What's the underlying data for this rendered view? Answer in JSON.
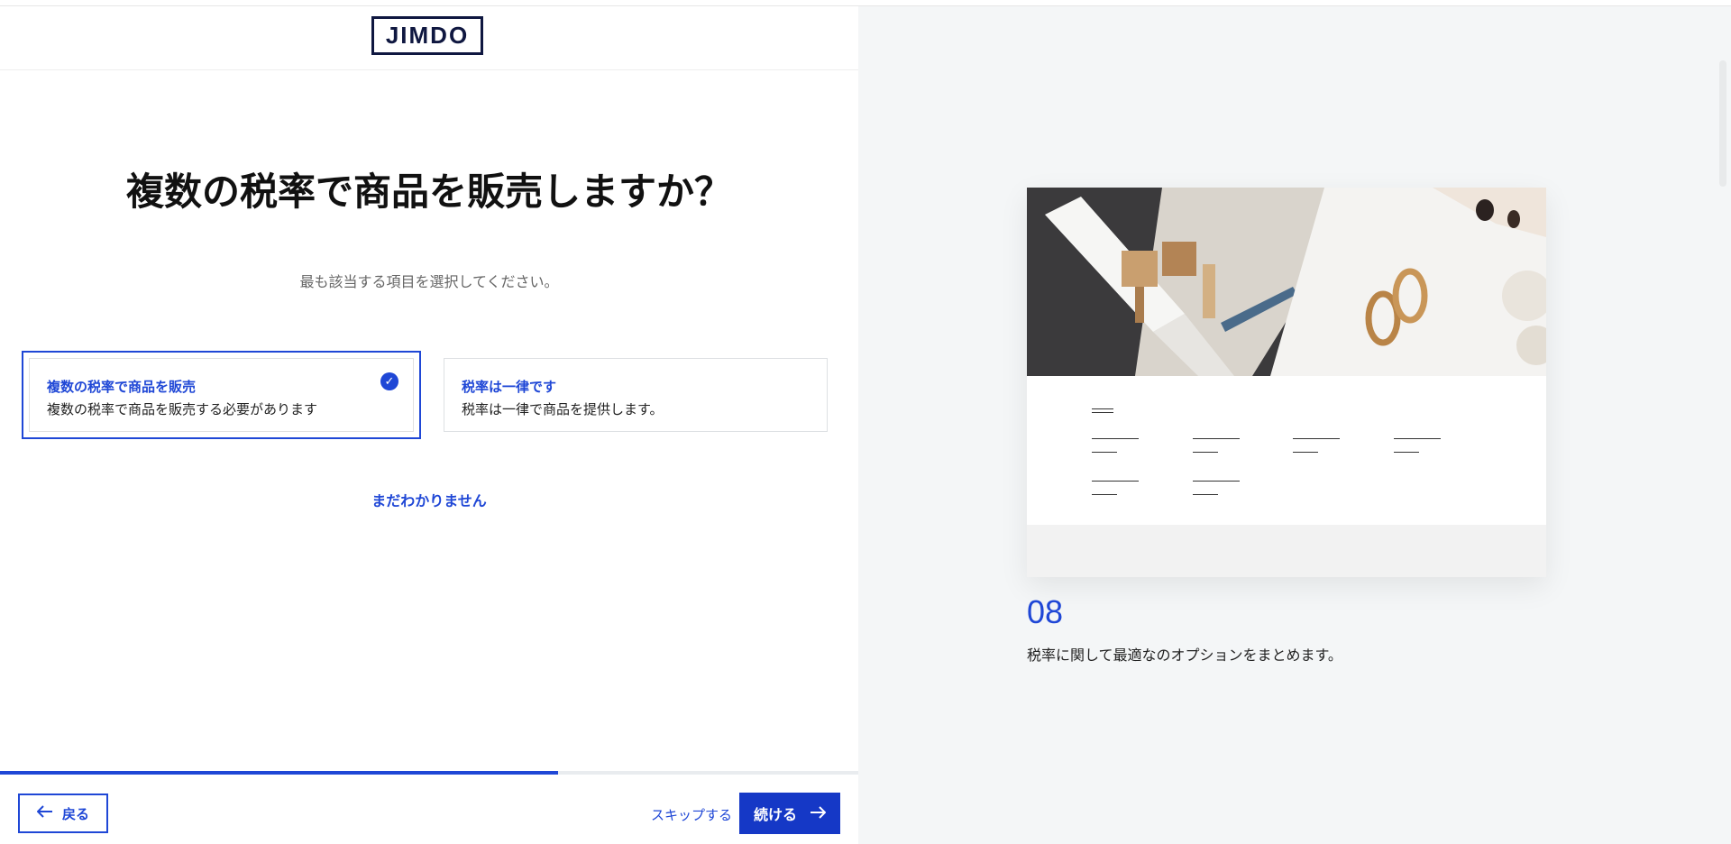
{
  "header": {
    "logo_text": "JIMDO"
  },
  "question": {
    "title": "複数の税率で商品を販売しますか？",
    "subtitle": "最も該当する項目を選択してください。"
  },
  "options": [
    {
      "title": "複数の税率で商品を販売",
      "description": "複数の税率で商品を販売する必要があります",
      "selected": true
    },
    {
      "title": "税率は一律です",
      "description": "税率は一律で商品を提供します。",
      "selected": false
    }
  ],
  "not_sure_label": "まだわかりません",
  "progress": {
    "fraction": 0.65
  },
  "footer": {
    "back_label": "戻る",
    "skip_label": "スキップする",
    "continue_label": "続ける"
  },
  "side_panel": {
    "step_number": "08",
    "step_text": "税率に関して最適なのオプションをまとめます。"
  },
  "colors": {
    "accent": "#1f47d6",
    "logo": "#0f1740",
    "panel_bg": "#f4f6f7"
  }
}
